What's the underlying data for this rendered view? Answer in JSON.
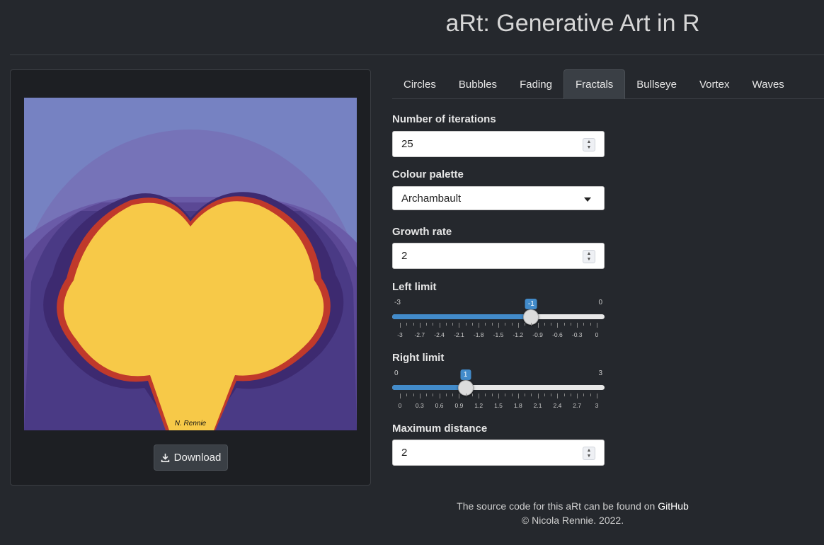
{
  "app_title": "aRt: Generative Art in R",
  "art": {
    "signature": "N. Rennie",
    "colors": {
      "background": "#7682c2",
      "light": "#7673b8",
      "mid": "#6a5ba8",
      "dark": "#5b4895",
      "deep": "#3d2a70",
      "core": "#f7c948",
      "edge": "#c0392b"
    }
  },
  "download": {
    "label": "Download",
    "icon": "download-icon"
  },
  "tabs": [
    {
      "label": "Circles"
    },
    {
      "label": "Bubbles"
    },
    {
      "label": "Fading"
    },
    {
      "label": "Fractals",
      "active": true
    },
    {
      "label": "Bullseye"
    },
    {
      "label": "Vortex"
    },
    {
      "label": "Waves"
    }
  ],
  "controls": {
    "iterations": {
      "label": "Number of iterations",
      "value": "25"
    },
    "palette": {
      "label": "Colour palette",
      "value": "Archambault"
    },
    "growth": {
      "label": "Growth rate",
      "value": "2"
    },
    "left_limit": {
      "label": "Left limit",
      "min": -3,
      "max": 0,
      "value": -1,
      "min_label": "-3",
      "max_label": "0",
      "value_label": "-1",
      "ticks": [
        "-3",
        "-2.7",
        "-2.4",
        "-2.1",
        "-1.8",
        "-1.5",
        "-1.2",
        "-0.9",
        "-0.6",
        "-0.3",
        "0"
      ]
    },
    "right_limit": {
      "label": "Right limit",
      "min": 0,
      "max": 3,
      "value": 1,
      "min_label": "0",
      "max_label": "3",
      "value_label": "1",
      "ticks": [
        "0",
        "0.3",
        "0.6",
        "0.9",
        "1.2",
        "1.5",
        "1.8",
        "2.1",
        "2.4",
        "2.7",
        "3"
      ]
    },
    "max_distance": {
      "label": "Maximum distance",
      "value": "2"
    }
  },
  "footer": {
    "line1_text": "The source code for this aRt can be found on",
    "link_label": "GitHub",
    "line2": "© Nicola Rennie. 2022."
  },
  "accent_color": "#428bca"
}
